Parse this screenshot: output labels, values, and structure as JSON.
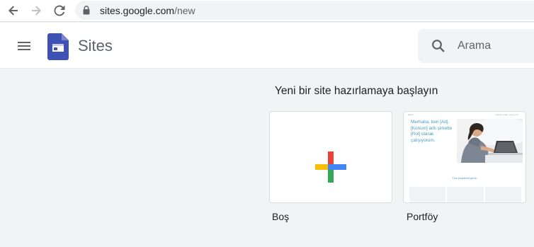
{
  "browser": {
    "url_domain": "sites.google.com",
    "url_path": "/new"
  },
  "header": {
    "app_name": "Sites",
    "search_placeholder": "Arama"
  },
  "main": {
    "heading": "Yeni bir site hazırlamaya başlayın",
    "templates": [
      {
        "label": "Boş"
      },
      {
        "label": "Portföy",
        "preview": {
          "brand": "Sitem",
          "nav": "Hakkımda İletişim",
          "intro": "Merhaba, ben [Ad]. [Konum] adlı şirkette [Rol] olarak çalışıyorum.",
          "link": "Tüm projelerimi görün"
        }
      }
    ]
  },
  "colors": {
    "accent_blue": "#4285f4",
    "accent_red": "#ea4335",
    "accent_yellow": "#fbbc04",
    "accent_green": "#34a853",
    "sites_logo": "#3f51b5"
  }
}
